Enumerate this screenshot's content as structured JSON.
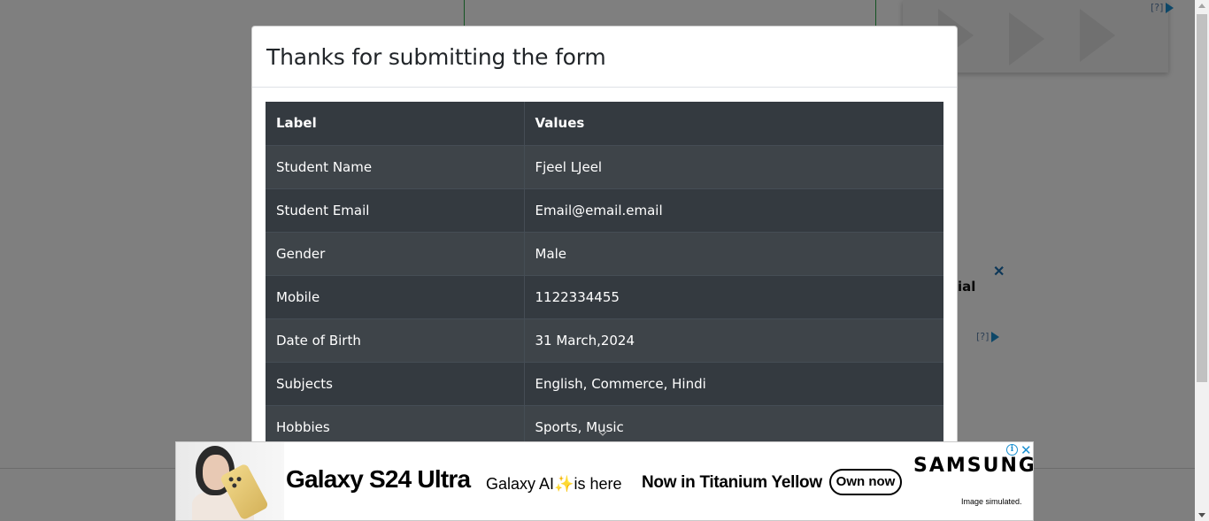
{
  "modal": {
    "title": "Thanks for submitting the form",
    "table": {
      "headers": [
        "Label",
        "Values"
      ],
      "rows": [
        [
          "Student Name",
          "Fjeel LJeel"
        ],
        [
          "Student Email",
          "Email@email.email"
        ],
        [
          "Gender",
          "Male"
        ],
        [
          "Mobile",
          "1122334455"
        ],
        [
          "Date of Birth",
          "31 March,2024"
        ],
        [
          "Subjects",
          "English, Commerce, Hindi"
        ],
        [
          "Hobbies",
          "Sports, Music"
        ]
      ]
    }
  },
  "background": {
    "ad_tag_text": "[?]",
    "fragment_text": "ial",
    "close_glyph": "✕"
  },
  "ad": {
    "model": "Galaxy S24 Ultra",
    "ai_prefix": "Galaxy AI",
    "ai_suffix": "is here",
    "sparkle": "✨",
    "tagline": "Now in Titanium Yellow",
    "cta": "Own now",
    "brand": "SAMSUNG",
    "note": "Image simulated.",
    "info_glyph": "i",
    "close_glyph": "✕"
  },
  "colors": {
    "table_bg": "#343a40",
    "overlay": "rgba(0,0,0,0.5)",
    "accent_green": "#28a745"
  }
}
